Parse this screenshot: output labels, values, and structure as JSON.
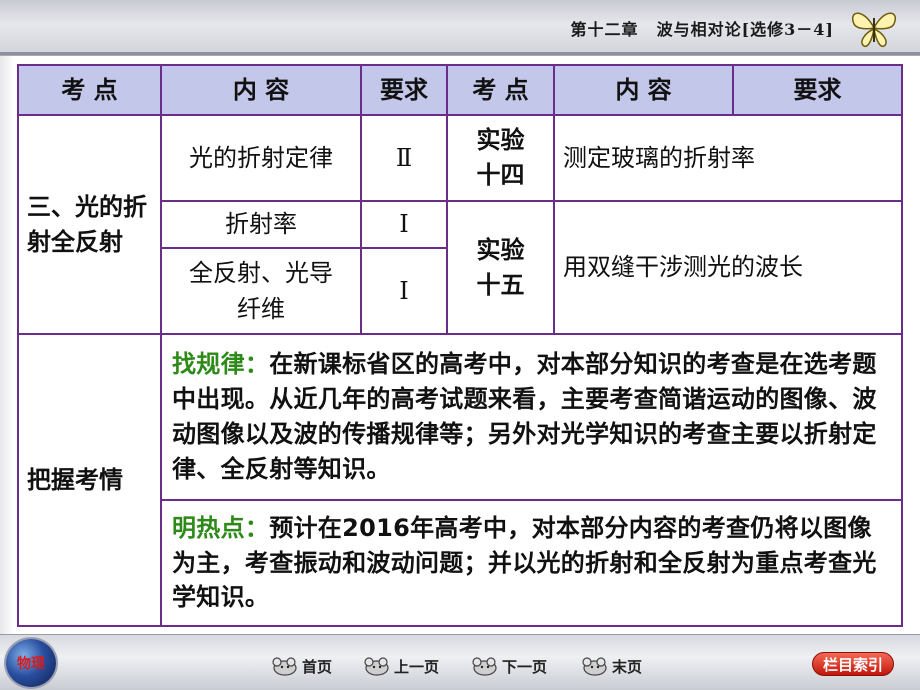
{
  "header": {
    "chapter": "第十二章",
    "title": "波与相对论",
    "module": "[选修3－4]"
  },
  "table": {
    "columns": [
      "考 点",
      "内 容",
      "要求",
      "考 点",
      "内 容",
      "要求"
    ],
    "section_topic": "三、光的折射全反射",
    "rows_left": [
      {
        "content": "光的折射定律",
        "level": "Ⅱ"
      },
      {
        "content": "折射率",
        "level": "Ⅰ"
      },
      {
        "content": "全反射、光导纤维",
        "level": "Ⅰ"
      }
    ],
    "experiments": [
      {
        "name": "实验十四",
        "content": "测定玻璃的折射率"
      },
      {
        "name": "实验十五",
        "content": "用双缝干涉测光的波长"
      }
    ],
    "analysis_label": "把握考情",
    "pattern_label": "找规律：",
    "pattern_text": "在新课标省区的高考中，对本部分知识的考查是在选考题中出现。从近几年的高考试题来看，主要考查简谐运动的图像、波动图像以及波的传播规律等；另外对光学知识的考查主要以折射定律、全反射等知识。",
    "hotspot_label": "明热点：",
    "hotspot_text": "预计在2016年高考中，对本部分内容的考查仍将以图像为主，考查振动和波动问题；并以光的折射和全反射为重点考查光学知识。"
  },
  "footer": {
    "logo_text": "物理",
    "nav": {
      "home": "首页",
      "prev": "上一页",
      "next": "下一页",
      "last": "末页"
    },
    "index_button": "栏目索引"
  }
}
